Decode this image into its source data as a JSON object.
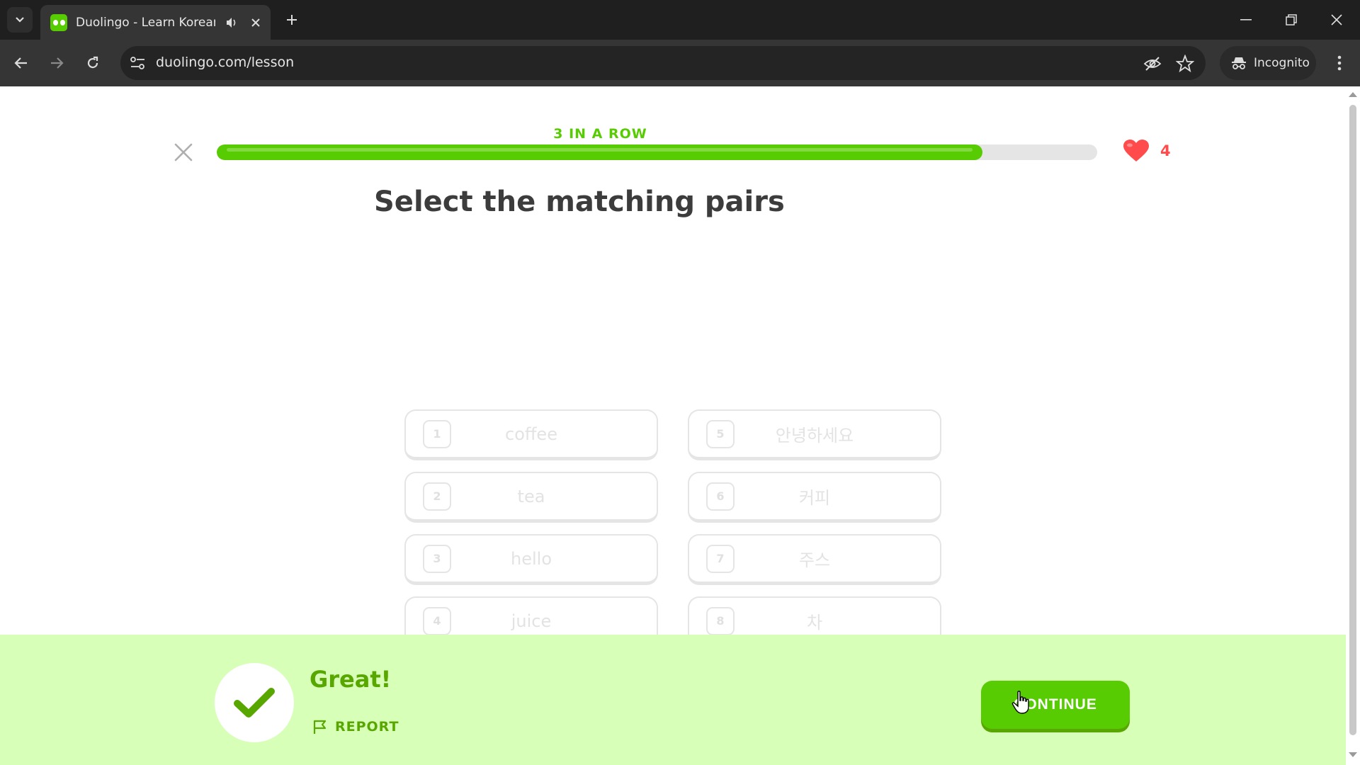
{
  "browser": {
    "tab_title": "Duolingo - Learn Korean with",
    "url": "duolingo.com/lesson",
    "incognito_label": "Incognito",
    "icons": [
      "tab-search-chevron-icon",
      "speaker-icon",
      "close-icon",
      "plus-icon",
      "minimize-icon",
      "restore-icon",
      "window-close-icon",
      "back-arrow-icon",
      "forward-arrow-icon",
      "reload-icon",
      "site-settings-icon",
      "eye-off-icon",
      "star-icon",
      "incognito-icon",
      "kebab-menu-icon"
    ]
  },
  "lesson": {
    "streak_label": "3 IN A ROW",
    "progress_fraction": 0.87,
    "hearts_count": "4",
    "title": "Select the matching pairs",
    "choices": [
      {
        "num": "1",
        "text": "coffee"
      },
      {
        "num": "5",
        "text": "안녕하세요"
      },
      {
        "num": "2",
        "text": "tea"
      },
      {
        "num": "6",
        "text": "커피"
      },
      {
        "num": "3",
        "text": "hello"
      },
      {
        "num": "7",
        "text": "주스"
      },
      {
        "num": "4",
        "text": "juice"
      },
      {
        "num": "8",
        "text": "차"
      }
    ]
  },
  "feedback": {
    "message": "Great!",
    "report_label": "REPORT",
    "continue_label": "CONTINUE"
  },
  "colors": {
    "brand_green": "#58cc02",
    "feedback_bg": "#d7ffb8",
    "feedback_text": "#58a700",
    "heart": "#ff4b4b"
  }
}
